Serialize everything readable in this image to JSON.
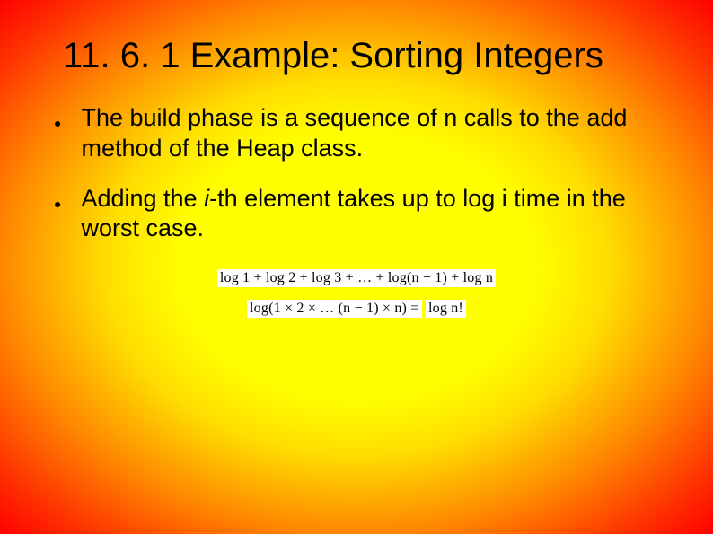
{
  "title": "11. 6. 1 Example: Sorting Integers",
  "bullets": [
    {
      "pre": "The build phase is a sequence of n calls to the add method of the Heap class.",
      "italic": "",
      "post": ""
    },
    {
      "pre": "Adding the ",
      "italic": "i",
      "post": "-th element takes up to log i time in the worst case."
    }
  ],
  "formulas": {
    "line1": "log 1  +  log 2  +  log 3  +  …  + log(n − 1)  +  log n",
    "line2_left": "log(1  ×  2  ×  …  (n − 1)  × n)  =  ",
    "line2_right": "log n!"
  }
}
